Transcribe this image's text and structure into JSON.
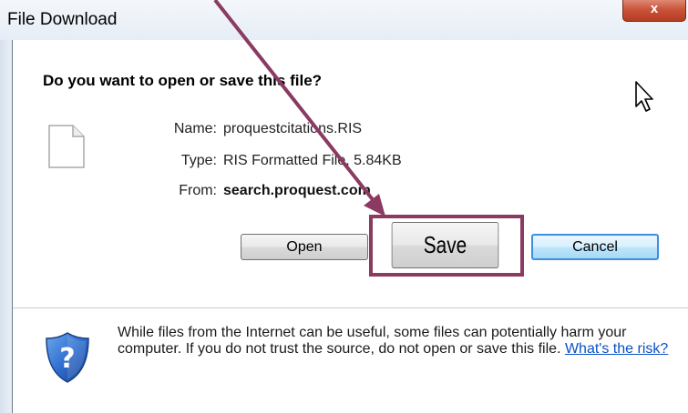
{
  "window": {
    "title": "File Download",
    "close_label": "x"
  },
  "dialog": {
    "question": "Do you want to open or save this file?",
    "file_icon": "blank-document-icon",
    "info": {
      "name_label": "Name:",
      "name_value": "proquestcitations.RIS",
      "type_label": "Type:",
      "type_value": "RIS Formatted File, 5.84KB",
      "from_label": "From:",
      "from_value": "search.proquest.com"
    },
    "buttons": {
      "open": "Open",
      "save": "Save",
      "cancel": "Cancel"
    },
    "warning": {
      "icon": "shield-question-icon",
      "text": "While files from the Internet can be useful, some files can potentially harm your computer. If you do not trust the source, do not open or save this file.",
      "link": "What's the risk?"
    }
  },
  "annotation": {
    "highlight_color": "#8b3a62",
    "arrow_target": "Save"
  }
}
